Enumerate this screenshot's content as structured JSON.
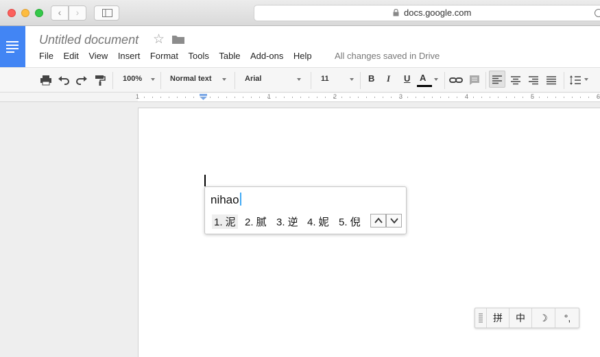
{
  "browser": {
    "url": "docs.google.com",
    "back_glyph": "‹",
    "forward_glyph": "›"
  },
  "docs": {
    "title": "Untitled document",
    "star_glyph": "☆",
    "menu": [
      "File",
      "Edit",
      "View",
      "Insert",
      "Format",
      "Tools",
      "Table",
      "Add-ons",
      "Help"
    ],
    "save_status": "All changes saved in Drive",
    "accent_color": "#4285f4"
  },
  "toolbar": {
    "zoom": "100%",
    "style": "Normal text",
    "font": "Arial",
    "font_size": "11",
    "bold": "B",
    "italic": "I",
    "underline": "U",
    "text_color": "A"
  },
  "ruler": {
    "numbers": [
      "1",
      "1",
      "2",
      "3",
      "4",
      "5",
      "6"
    ]
  },
  "ime_popup": {
    "input": "nihao",
    "candidates": [
      "1. 泥",
      "2. 腻",
      "3. 逆",
      "4. 妮",
      "5. 倪"
    ],
    "selected_index": 0
  },
  "ime_toolbar": {
    "items": [
      "拼",
      "中",
      "☽",
      "°,"
    ]
  }
}
